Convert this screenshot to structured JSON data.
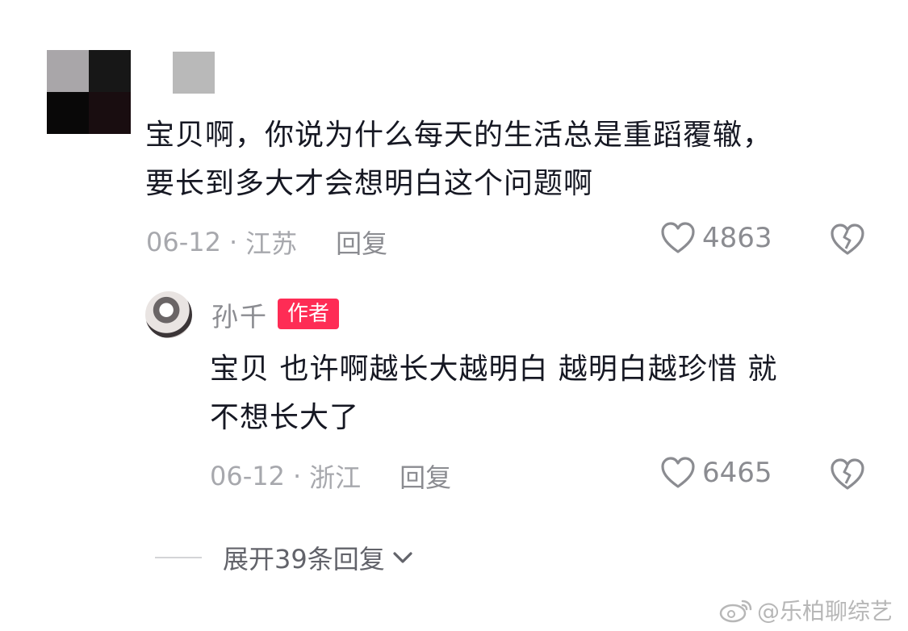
{
  "comment": {
    "avatar_icon": "blurred-avatar",
    "text_line1": "宝贝啊，你说为什么每天的生活总是重蹈覆辙，",
    "text_line2": "要长到多大才会想明白这个问题啊",
    "date": "06-12",
    "separator": "·",
    "location": "江苏",
    "reply_label": "回复",
    "like_count": "4863",
    "like_icon": "heart-outline-icon",
    "dislike_icon": "broken-heart-icon"
  },
  "reply": {
    "author_name": "孙千",
    "author_badge": "作者",
    "text_line1": "宝贝 也许啊越长大越明白 越明白越珍惜 就",
    "text_line2": "不想长大了",
    "date": "06-12",
    "separator": "·",
    "location": "浙江",
    "reply_label": "回复",
    "like_count": "6465",
    "like_icon": "heart-outline-icon",
    "dislike_icon": "broken-heart-icon"
  },
  "expand": {
    "label": "展开39条回复",
    "icon": "chevron-down-icon"
  },
  "watermark": {
    "text": "@乐柏聊综艺",
    "icon": "weibo-icon"
  }
}
